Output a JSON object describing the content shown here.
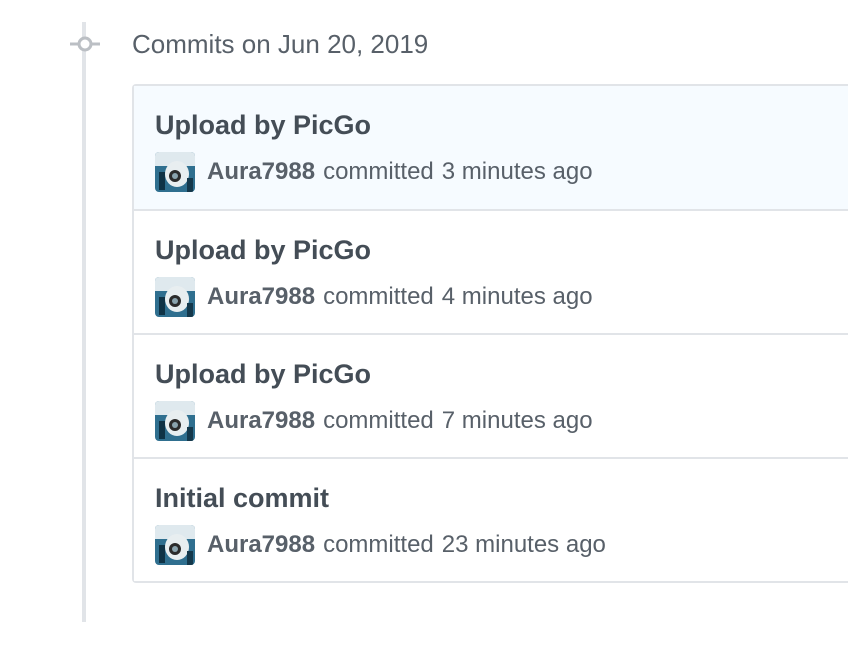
{
  "group": {
    "title": "Commits on Jun 20, 2019"
  },
  "commits": [
    {
      "title": "Upload by PicGo",
      "author": "Aura7988",
      "action": "committed",
      "time": "3 minutes ago"
    },
    {
      "title": "Upload by PicGo",
      "author": "Aura7988",
      "action": "committed",
      "time": "4 minutes ago"
    },
    {
      "title": "Upload by PicGo",
      "author": "Aura7988",
      "action": "committed",
      "time": "7 minutes ago"
    },
    {
      "title": "Initial commit",
      "author": "Aura7988",
      "action": "committed",
      "time": "23 minutes ago"
    }
  ],
  "colors": {
    "row_highlight": "#f6fbff",
    "border": "#e1e4e8",
    "muted_text": "#586069",
    "title_text": "#444d56"
  },
  "icons": {
    "timeline_node": "git-commit-icon",
    "avatar": "avatar"
  }
}
